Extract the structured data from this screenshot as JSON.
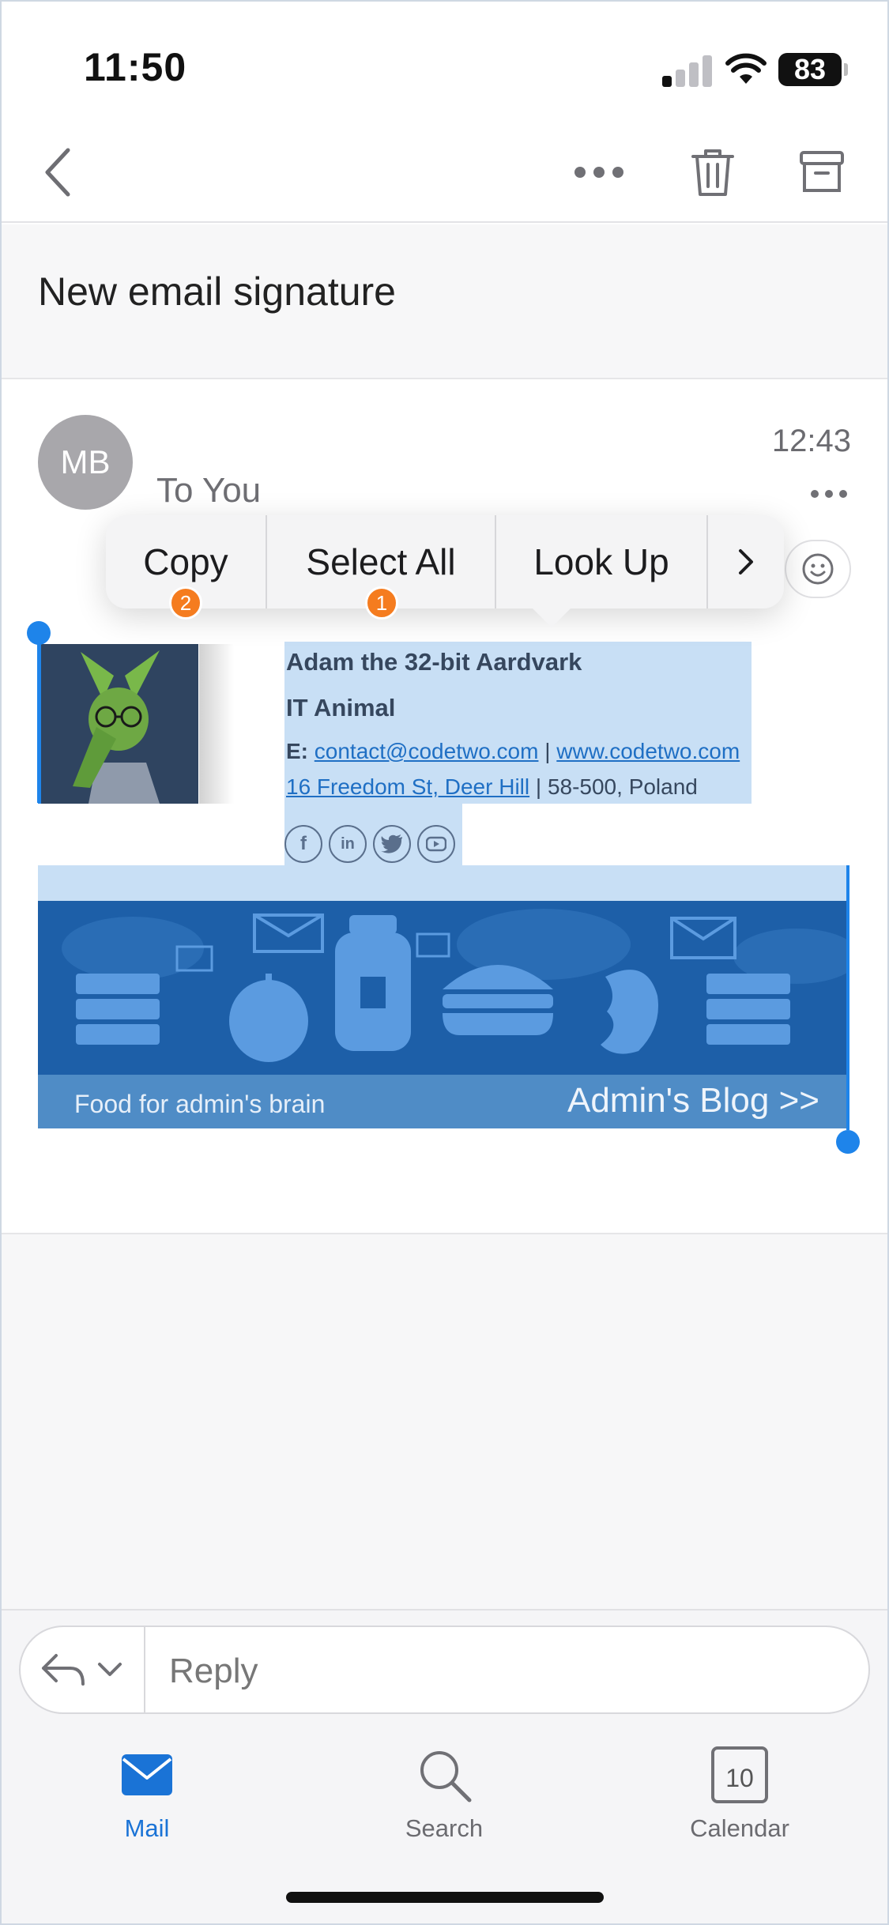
{
  "status_bar": {
    "time": "11:50",
    "battery": "83",
    "icons": [
      "cellular-signal-icon",
      "wifi-icon",
      "battery-icon"
    ]
  },
  "toolbar": {
    "icons": [
      "back-chevron-icon",
      "more-horizontal-icon",
      "trash-icon",
      "archive-icon"
    ]
  },
  "subject": "New email signature",
  "message": {
    "avatar_initials": "MB",
    "time": "12:43",
    "to_line": "To You"
  },
  "context_menu": {
    "items": [
      {
        "label": "Copy",
        "badge": "2"
      },
      {
        "label": "Select All",
        "badge": "1"
      },
      {
        "label": "Look Up"
      }
    ],
    "next_icon": "chevron-right-icon"
  },
  "signature": {
    "name": "Adam the 32-bit Aardvark",
    "role": "IT Animal",
    "email_label": "E:",
    "email": "contact@codetwo.com",
    "separator": "|",
    "website": "www.codetwo.com",
    "address_link": "16 Freedom St, Deer Hill",
    "address_rest": "| 58-500, Poland",
    "social_icons": [
      "facebook-icon",
      "linkedin-icon",
      "twitter-icon",
      "youtube-icon"
    ]
  },
  "banner": {
    "tagline": "Food for admin's brain",
    "link": "Admin's Blog >>"
  },
  "reply": {
    "placeholder": "Reply",
    "icons": [
      "reply-arrow-icon",
      "chevron-down-icon"
    ]
  },
  "tabs": [
    {
      "label": "Mail",
      "icon": "mail-icon",
      "active": true
    },
    {
      "label": "Search",
      "icon": "search-icon",
      "active": false
    },
    {
      "label": "Calendar",
      "icon": "calendar-icon",
      "day": "10",
      "active": false
    }
  ],
  "colors": {
    "accent": "#1a73d6",
    "selection": "#c8dff5",
    "handle": "#1e84ea",
    "badge": "#f57c1f",
    "banner": "#1d5fa8"
  }
}
